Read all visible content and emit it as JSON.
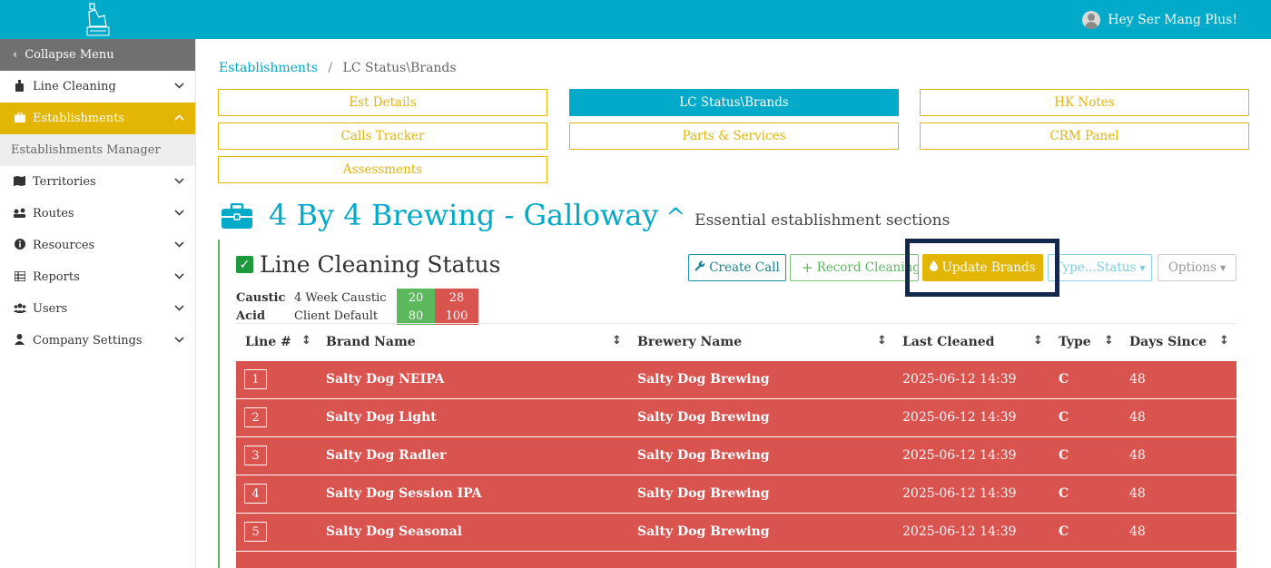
{
  "user": {
    "greeting": "Hey Ser Mang Plus!"
  },
  "sidebar": {
    "collapse_label": "Collapse Menu",
    "items": [
      {
        "label": "Line Cleaning",
        "icon": "bottle-icon"
      },
      {
        "label": "Establishments",
        "icon": "briefcase-icon",
        "active": true
      },
      {
        "label": "Establishments Manager",
        "sub": true
      },
      {
        "label": "Territories",
        "icon": "map-icon"
      },
      {
        "label": "Routes",
        "icon": "route-icon"
      },
      {
        "label": "Resources",
        "icon": "info-icon"
      },
      {
        "label": "Reports",
        "icon": "list-icon"
      },
      {
        "label": "Users",
        "icon": "users-icon"
      },
      {
        "label": "Company Settings",
        "icon": "user-icon"
      }
    ]
  },
  "breadcrumb": {
    "root": "Establishments",
    "separator": "/",
    "current": "LC Status\\Brands"
  },
  "tabs": [
    "Est Details",
    "LC Status\\Brands",
    "HK Notes",
    "Calls Tracker",
    "Parts & Services",
    "CRM Panel",
    "Assessments"
  ],
  "active_tab": "LC Status\\Brands",
  "heading": {
    "name": "4 By 4 Brewing - Galloway",
    "caret": "^",
    "description": "Essential establishment sections"
  },
  "panel": {
    "title": "Line Cleaning Status",
    "buttons": {
      "create_call": "Create Call",
      "record_cleaning": "Record Cleaning",
      "update_brands": "Update Brands",
      "type_status": "Type...Status",
      "options": "Options"
    },
    "schedule": [
      {
        "key": "Caustic",
        "value": "4 Week Caustic",
        "green": "20",
        "red": "28"
      },
      {
        "key": "Acid",
        "value": "Client Default",
        "green": "80",
        "red": "100"
      }
    ]
  },
  "table": {
    "headers": [
      "Line #",
      "Brand Name",
      "Brewery Name",
      "Last Cleaned",
      "Type",
      "Days Since"
    ],
    "rows": [
      {
        "line": "1",
        "brand": "Salty Dog NEIPA",
        "brewery": "Salty Dog Brewing",
        "last_cleaned": "2025-06-12 14:39",
        "type": "C",
        "days": "48"
      },
      {
        "line": "2",
        "brand": "Salty Dog Light",
        "brewery": "Salty Dog Brewing",
        "last_cleaned": "2025-06-12 14:39",
        "type": "C",
        "days": "48"
      },
      {
        "line": "3",
        "brand": "Salty Dog Radler",
        "brewery": "Salty Dog Brewing",
        "last_cleaned": "2025-06-12 14:39",
        "type": "C",
        "days": "48"
      },
      {
        "line": "4",
        "brand": "Salty Dog Session IPA",
        "brewery": "Salty Dog Brewing",
        "last_cleaned": "2025-06-12 14:39",
        "type": "C",
        "days": "48"
      },
      {
        "line": "5",
        "brand": "Salty Dog Seasonal",
        "brewery": "Salty Dog Brewing",
        "last_cleaned": "2025-06-12 14:39",
        "type": "C",
        "days": "48"
      }
    ]
  },
  "colors": {
    "primary": "#00aac8",
    "accent": "#e3b505",
    "danger": "#d9534f",
    "success": "#5cb85c",
    "highlight_frame": "#13294b"
  }
}
